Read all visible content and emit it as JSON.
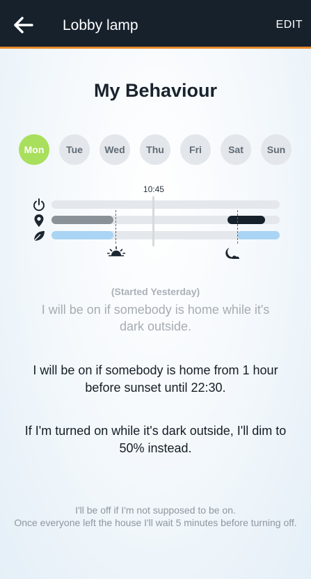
{
  "header": {
    "title": "Lobby lamp",
    "edit_label": "EDIT",
    "bar_color": "#16212c",
    "accent_color": "#e88a2e"
  },
  "heading": "My Behaviour",
  "days": [
    {
      "label": "Mon",
      "selected": true
    },
    {
      "label": "Tue",
      "selected": false
    },
    {
      "label": "Wed",
      "selected": false
    },
    {
      "label": "Thu",
      "selected": false
    },
    {
      "label": "Fri",
      "selected": false
    },
    {
      "label": "Sat",
      "selected": false
    },
    {
      "label": "Sun",
      "selected": false
    }
  ],
  "timeline": {
    "current_time": "10:45",
    "rows": [
      {
        "icon": "power-icon",
        "segments": []
      },
      {
        "icon": "location-pin-icon",
        "segments": [
          {
            "from": "00:00",
            "to": "06:30",
            "color": "#8a9298"
          },
          {
            "from": "18:30",
            "to": "22:30",
            "color": "#16212c"
          }
        ]
      },
      {
        "icon": "leaf-icon",
        "segments": [
          {
            "from": "00:00",
            "to": "06:30",
            "color": "#aad4f3"
          },
          {
            "from": "19:30",
            "to": "24:00",
            "color": "#aad4f3"
          }
        ]
      }
    ],
    "markers": [
      {
        "icon": "sunrise-icon",
        "time": "06:45"
      },
      {
        "icon": "moon-icon",
        "time": "19:30"
      }
    ]
  },
  "previous_behaviour": {
    "status": "(Started Yesterday)",
    "text": "I will be on if somebody is home while it's dark outside."
  },
  "descriptions": [
    "I will be on if somebody is home from 1 hour before sunset until 22:30.",
    "If I'm turned on while it's dark outside, I'll dim to 50% instead."
  ],
  "footer": {
    "line1": "I'll be off if I'm not supposed to be on.",
    "line2": "Once everyone left the house I'll wait 5 minutes before turning off."
  },
  "colors": {
    "active_day": "#a8df5c",
    "inactive_day": "#e3e6ea",
    "track": "#e4e8ec"
  }
}
